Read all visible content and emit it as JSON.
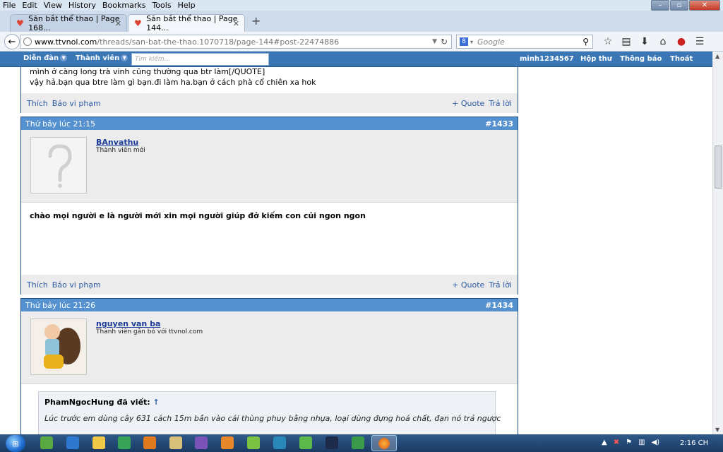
{
  "menu": [
    "File",
    "Edit",
    "View",
    "History",
    "Bookmarks",
    "Tools",
    "Help"
  ],
  "tabs": [
    {
      "title": "Săn bắt thể thao | Page 168...",
      "active": false
    },
    {
      "title": "Săn bắt thể thao | Page 144...",
      "active": true
    }
  ],
  "address": {
    "host": "www.ttvnol.com",
    "path": "/threads/san-bat-the-thao.1070718/page-144#post-22474886"
  },
  "search": {
    "placeholder": "Google"
  },
  "forum_nav": {
    "left": [
      "Diễn đàn",
      "Thành viên"
    ],
    "search_placeholder": "Tìm kiếm...",
    "right": [
      "minh1234567",
      "Hộp thư",
      "Thông báo",
      "Thoát"
    ]
  },
  "posts": [
    {
      "partial": true,
      "body_lines": [
        "mình ở càng long trà vinh cũng thường qua btr làm[/QUOTE]",
        "vậy hả.bạn qua btre làm gì bạn.đi làm ha.bạn ở cách phà cổ chiên xa hok"
      ],
      "actions_left": [
        "Thích",
        "Báo vi phạm"
      ],
      "actions_right": [
        "+ Quote",
        "Trả lời"
      ]
    },
    {
      "date": "Thứ bảy lúc 21:15",
      "number": "#1433",
      "username": "BAnvathu",
      "user_title": "Thành viên mới",
      "body": "chào mọi người e là người mới xin mọi người giúp đở kiếm con củi ngon ngon",
      "actions_left": [
        "Thích",
        "Báo vi phạm"
      ],
      "actions_right": [
        "+ Quote",
        "Trả lời"
      ]
    },
    {
      "date": "Thứ bảy lúc 21:26",
      "number": "#1434",
      "username": "nguyen van ba",
      "user_title": "Thành viên gắn bó với ttvnol.com",
      "quote_author": "PhamNgocHung đã viết:",
      "quote_arrow": "↑",
      "quote_text": "Lúc trước em dùng cây 631 cách 15m bắn vào cái thùng phuy bằng nhựa, loại dùng đựng hoá chất, đạn nó trả ngược"
    }
  ],
  "clock": "2:16 CH",
  "colors": {
    "forum_bar": "#3b76b5",
    "post_header": "#5591cf",
    "link": "#2d5aa8"
  }
}
